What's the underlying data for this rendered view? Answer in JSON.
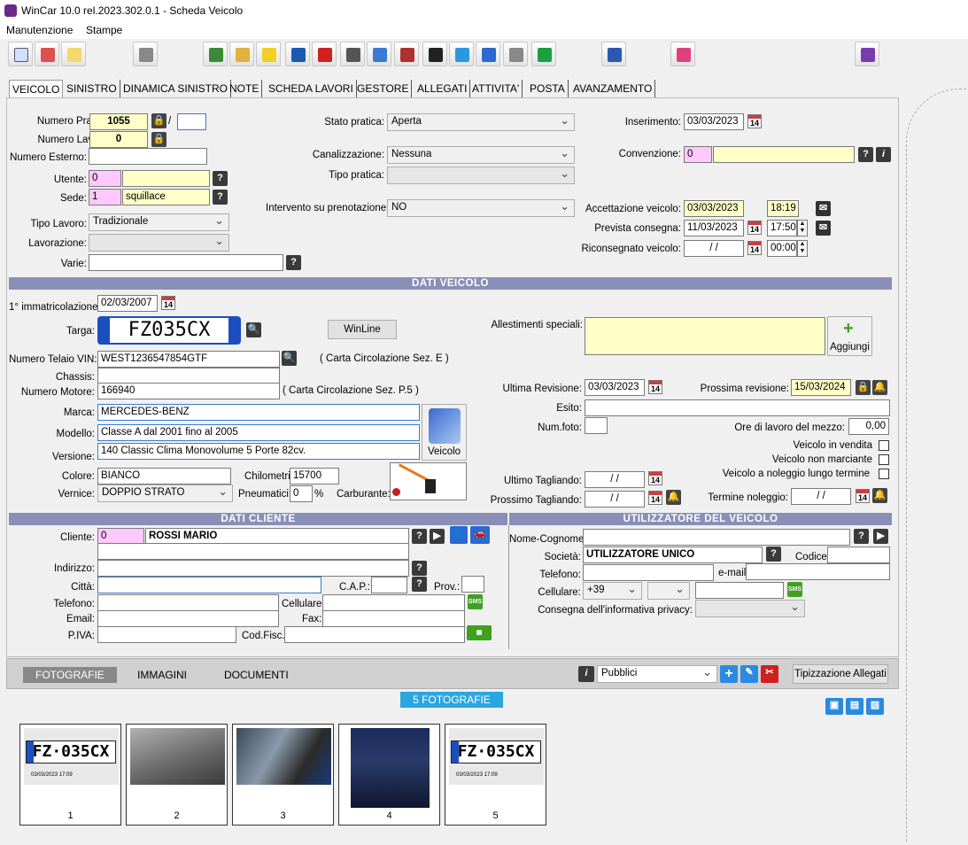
{
  "window": {
    "title": "WinCar 10.0 rel.2023.302.0.1 - Scheda Veicolo"
  },
  "menu": [
    "Manutenzione",
    "Stampe"
  ],
  "toolbar_icons": [
    "new-document-icon",
    "delete-document-icon",
    "search-document-icon",
    "print-icon",
    "tree-icon",
    "car-key-icon",
    "banana-icon",
    "car-icon",
    "first-aid-icon",
    "camera-icon",
    "book-icon",
    "tools-icon",
    "phone-camera-icon",
    "cloud-download-icon",
    "cart-icon",
    "wrench-cross-icon",
    "euro-icon",
    "card-reader-icon",
    "heart-icon",
    "exit-door-icon"
  ],
  "tabs": [
    "VEICOLO",
    "SINISTRO",
    "DINAMICA SINISTRO",
    "NOTE",
    "SCHEDA LAVORI",
    "GESTORE",
    "ALLEGATI",
    "ATTIVITA'",
    "POSTA",
    "AVANZAMENTO"
  ],
  "pratica": {
    "numero_pratica_label": "Numero Pratica:",
    "numero_pratica": "1055",
    "slash": "/",
    "numero_lavoro_label": "Numero Lavoro:",
    "numero_lavoro": "0",
    "numero_esterno_label": "Numero Esterno:",
    "utente_label": "Utente:",
    "utente_code": "0",
    "sede_label": "Sede:",
    "sede_code": "1",
    "sede_name": "squillace",
    "tipo_lavoro_label": "Tipo Lavoro:",
    "tipo_lavoro": "Tradizionale",
    "lavorazione_label": "Lavorazione:",
    "varie_label": "Varie:",
    "stato_label": "Stato pratica:",
    "stato": "Aperta",
    "canalizzazione_label": "Canalizzazione:",
    "canalizzazione": "Nessuna",
    "tipo_pratica_label": "Tipo pratica:",
    "prenotazione_label": "Intervento su prenotazione:",
    "prenotazione": "NO",
    "inserimento_label": "Inserimento:",
    "inserimento": "03/03/2023",
    "convenzione_label": "Convenzione:",
    "convenzione_code": "0",
    "accettazione_label": "Accettazione veicolo:",
    "accettazione_data": "03/03/2023",
    "accettazione_ora": "18:19",
    "prevista_label": "Prevista consegna:",
    "prevista_data": "11/03/2023",
    "prevista_ora": "17:50",
    "riconsegnato_label": "Riconsegnato veicolo:",
    "riconsegnato_data": "/ /",
    "riconsegnato_ora": "00:00"
  },
  "veicolo": {
    "section_title": "DATI  VEICOLO",
    "immatricolazione_label": "1° immatricolazione:",
    "immatricolazione": "02/03/2007",
    "targa_label": "Targa:",
    "targa": "FZ035CX",
    "winline": "WinLine",
    "telaio_label": "Numero Telaio VIN:",
    "telaio": "WEST1236547854GTF",
    "telaio_note": "( Carta Circolazione Sez. E )",
    "chassis_label": "Chassis:",
    "motore_label": "Numero Motore:",
    "motore": "166940",
    "motore_note": "( Carta Circolazione Sez. P.5 )",
    "marca_label": "Marca:",
    "marca": "MERCEDES-BENZ",
    "modello_label": "Modello:",
    "modello": "Classe A dal 2001 fino al 2005",
    "versione_label": "Versione:",
    "versione": "140 Classic Clima Monovolume 5 Porte 82cv.",
    "veicolo_btn": "Veicolo",
    "colore_label": "Colore:",
    "colore": "BIANCO",
    "vernice_label": "Vernice:",
    "vernice": "DOPPIO STRATO",
    "chilometri_label": "Chilometri:",
    "chilometri": "15700",
    "pneumatici_label": "Pneumatici:",
    "pneumatici": "0",
    "pct": "%",
    "carburante_label": "Carburante:",
    "allestimenti_label": "Allestimenti speciali:",
    "aggiungi": "Aggiungi",
    "ultima_rev_label": "Ultima Revisione:",
    "ultima_rev": "03/03/2023",
    "prossima_rev_label": "Prossima revisione:",
    "prossima_rev": "15/03/2024",
    "esito_label": "Esito:",
    "numfoto_label": "Num.foto:",
    "ore_label": "Ore di lavoro del mezzo:",
    "ore": "0,00",
    "vendita_label": "Veicolo in vendita",
    "non_marciante_label": "Veicolo non marciante",
    "noleggio_label": "Veicolo a noleggio lungo termine",
    "ultimo_tagl_label": "Ultimo Tagliando:",
    "ultimo_tagl": "/ /",
    "prossimo_tagl_label": "Prossimo Tagliando:",
    "prossimo_tagl": "/ /",
    "termine_label": "Termine noleggio:",
    "termine": "/ /"
  },
  "cliente": {
    "section_title": "DATI  CLIENTE",
    "cliente_label": "Cliente:",
    "cliente_code": "0",
    "cliente_name": "ROSSI MARIO",
    "indirizzo_label": "Indirizzo:",
    "citta_label": "Città:",
    "cap_label": "C.A.P.:",
    "prov_label": "Prov.:",
    "telefono_label": "Telefono:",
    "cellulare_label": "Cellulare:",
    "email_label": "Email:",
    "fax_label": "Fax:",
    "piva_label": "P.IVA:",
    "codfisc_label": "Cod.Fisc.:"
  },
  "utilizzatore": {
    "section_title": "UTILIZZATORE  DEL  VEICOLO",
    "nome_label": "Nome-Cognome:",
    "societa_label": "Società:",
    "societa": "UTILIZZATORE UNICO",
    "codice_label": "Codice:",
    "telefono_label": "Telefono:",
    "email_label": "e-mail:",
    "cellulare_label": "Cellulare:",
    "prefisso": "+39",
    "privacy_label": "Consegna dell'informativa privacy:"
  },
  "attachments": {
    "tabs": [
      "FOTOGRAFIE",
      "IMMAGINI",
      "DOCUMENTI"
    ],
    "filter": "Pubblici",
    "tipizzazione": "Tipizzazione Allegati",
    "count_label": "5 FOTOGRAFIE",
    "photos": [
      {
        "num": "1",
        "plate": "FZ·035CX",
        "date": "03/03/2023 17:09"
      },
      {
        "num": "2"
      },
      {
        "num": "3"
      },
      {
        "num": "4"
      },
      {
        "num": "5",
        "plate": "FZ·035CX",
        "date": "03/03/2023 17:09"
      }
    ]
  }
}
